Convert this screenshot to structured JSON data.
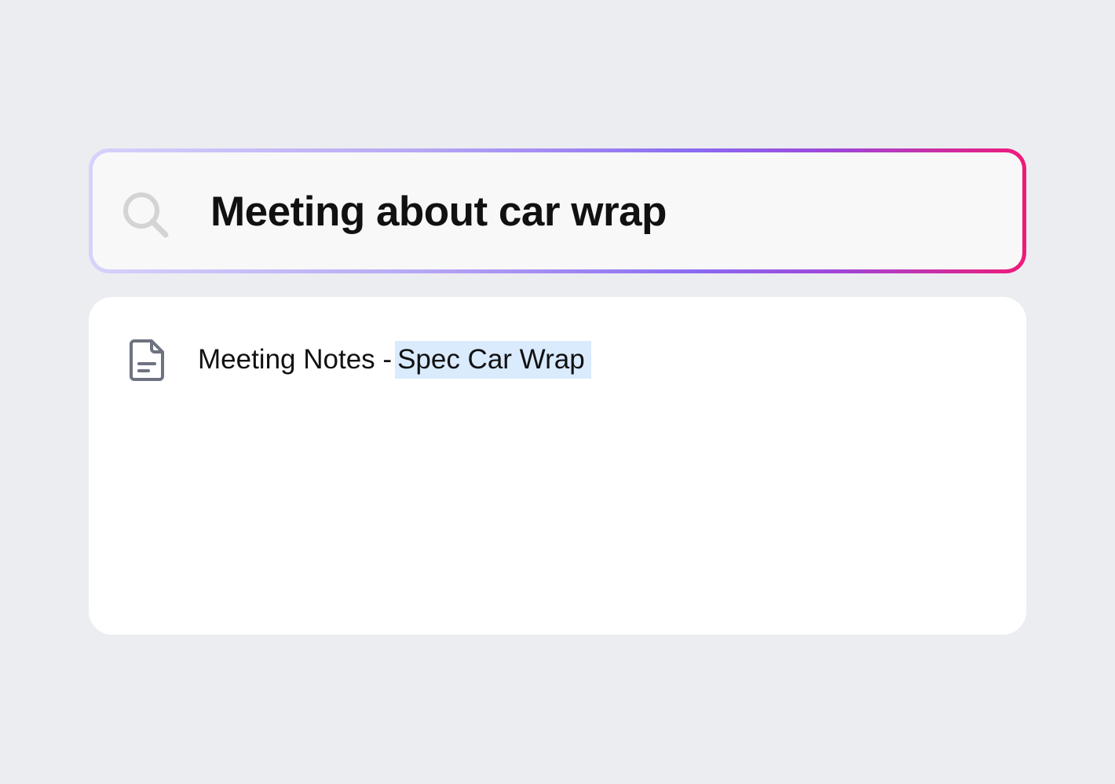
{
  "search": {
    "query": "Meeting about car wrap",
    "icon": "search-icon"
  },
  "results": [
    {
      "icon": "document-icon",
      "title_prefix": "Meeting Notes -",
      "title_highlight": "Spec Car Wrap"
    }
  ],
  "colors": {
    "background": "#ecedf1",
    "search_border_gradient": [
      "#d6d2fb",
      "#8a6af2",
      "#f01a78"
    ],
    "highlight": "#d9ebfd"
  }
}
